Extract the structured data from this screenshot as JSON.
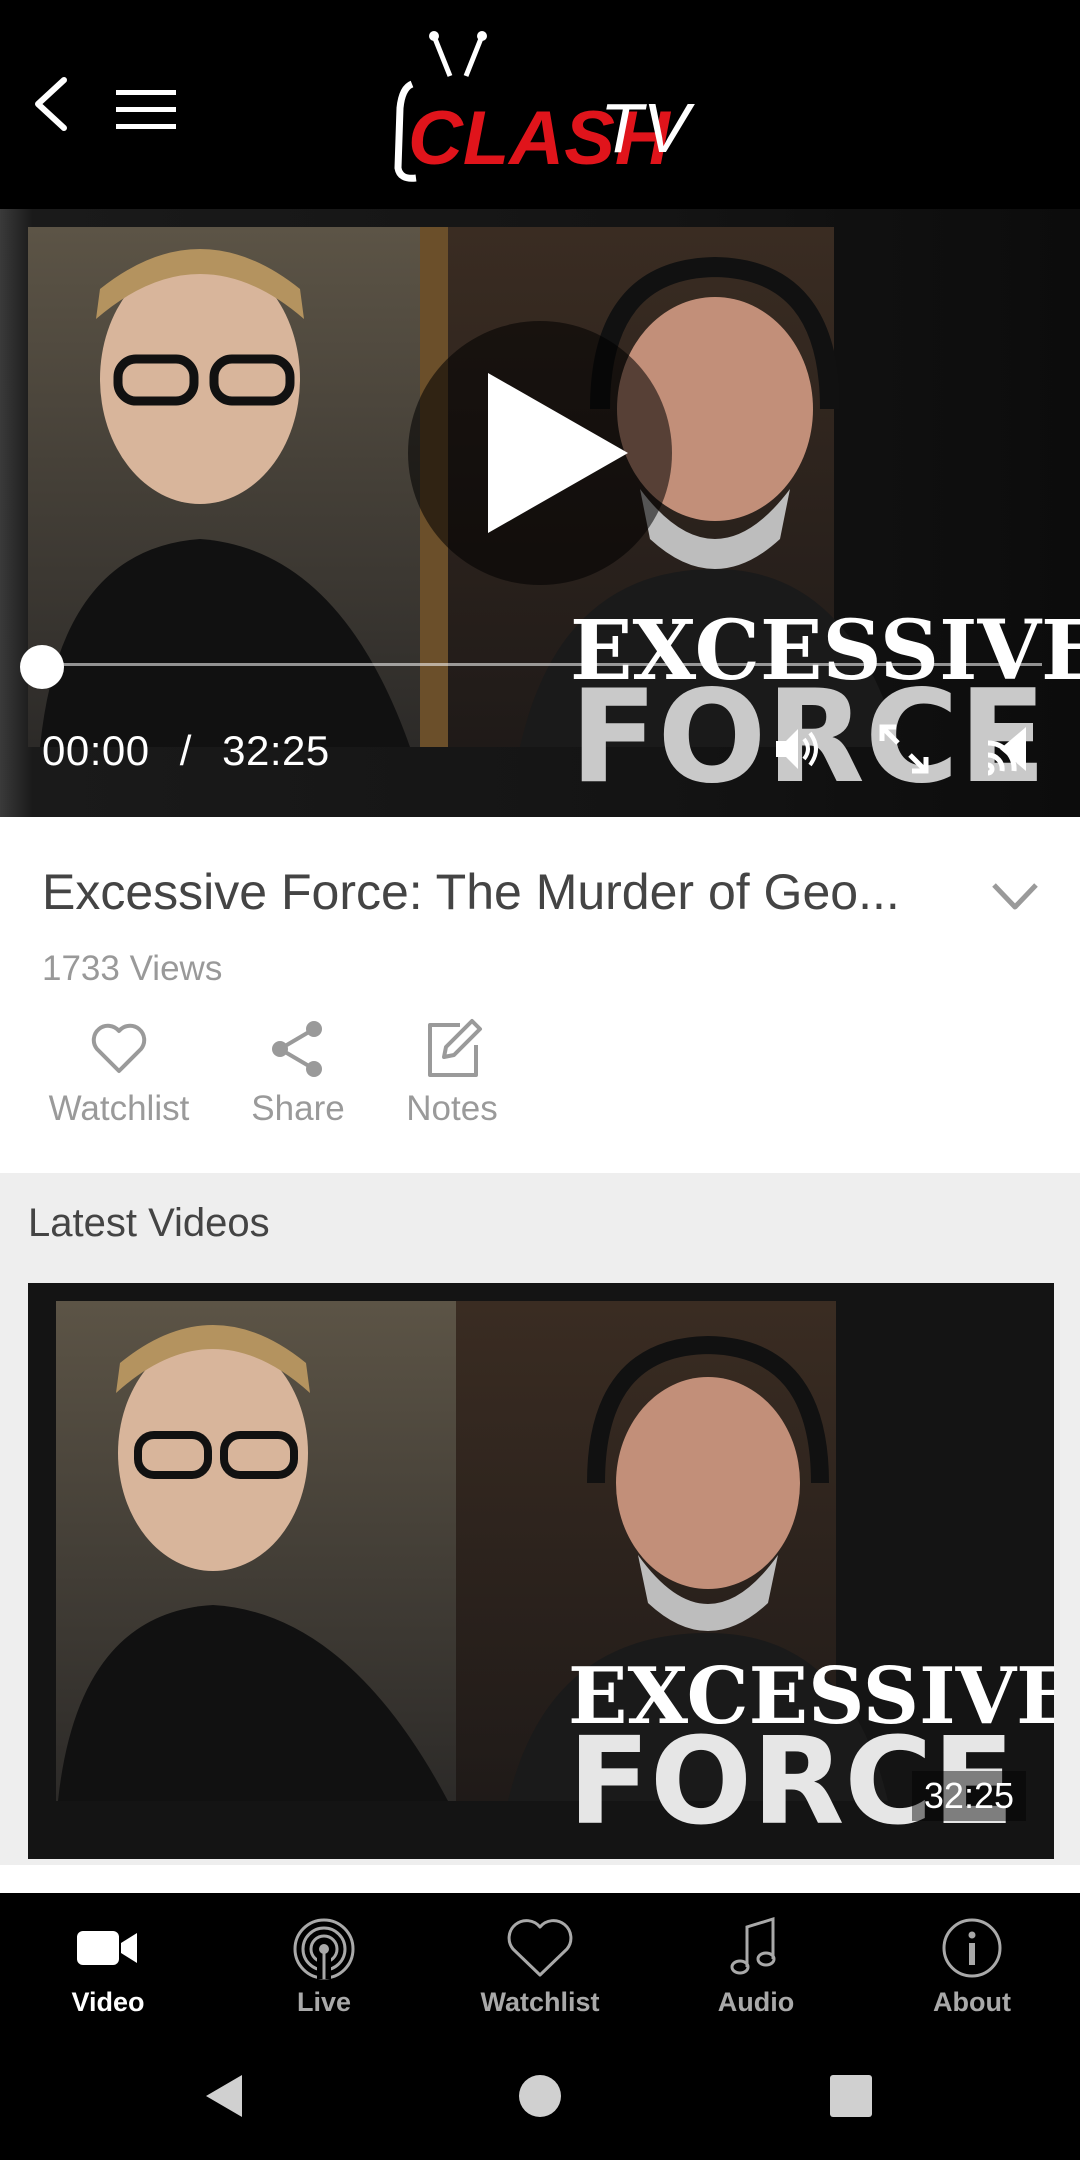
{
  "header": {
    "brand_logo": "CLASHTV",
    "back_icon": "back-arrow-icon",
    "menu_icon": "hamburger-menu-icon"
  },
  "player": {
    "current_time": "00:00",
    "separator": "/",
    "duration": "32:25",
    "progress": 0,
    "thumbnail_text_line1": "EXCESSIVE",
    "thumbnail_text_line2": "FORCE"
  },
  "video": {
    "title": "Excessive Force: The Murder of Geo...",
    "views": "1733 Views",
    "actions": [
      {
        "label": "Watchlist",
        "icon": "heart-icon"
      },
      {
        "label": "Share",
        "icon": "share-icon"
      },
      {
        "label": "Notes",
        "icon": "edit-note-icon"
      }
    ]
  },
  "latest": {
    "section_title": "Latest Videos",
    "items": [
      {
        "duration": "32:25",
        "thumb_line1": "EXCESSIVE",
        "thumb_line2": "FORCE"
      }
    ]
  },
  "bottom_nav": {
    "items": [
      {
        "label": "Video",
        "icon": "video-camera-icon",
        "active": true
      },
      {
        "label": "Live",
        "icon": "broadcast-icon",
        "active": false
      },
      {
        "label": "Watchlist",
        "icon": "heart-icon",
        "active": false
      },
      {
        "label": "Audio",
        "icon": "music-note-icon",
        "active": false
      },
      {
        "label": "About",
        "icon": "info-icon",
        "active": false
      }
    ]
  },
  "colors": {
    "brand_red": "#e0141b",
    "bar_background": "#000000",
    "section_background": "#eeeeee",
    "muted_text": "#9a9a9a"
  }
}
